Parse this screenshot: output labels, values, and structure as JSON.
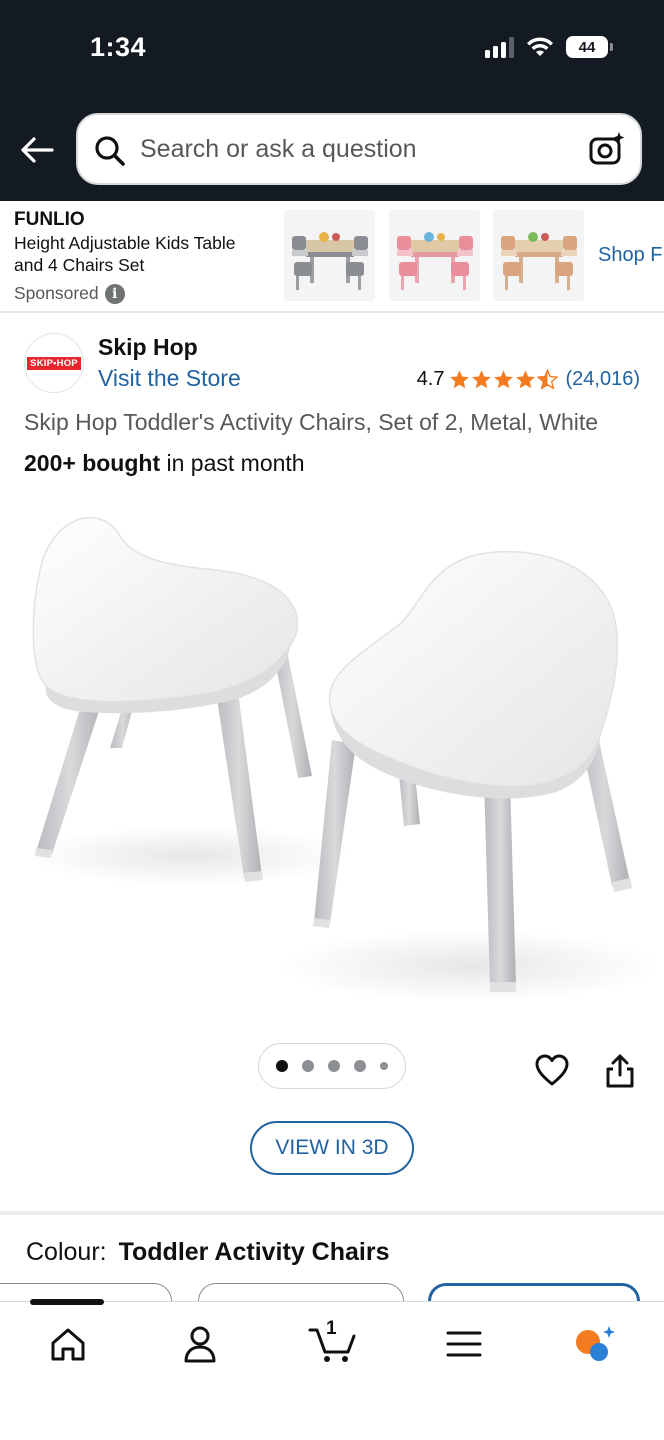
{
  "status_bar": {
    "time": "1:34",
    "battery": "44"
  },
  "search": {
    "placeholder": "Search or ask a question"
  },
  "sponsored_ad": {
    "brand": "FUNLIO",
    "title": "Height Adjustable Kids Table and 4 Chairs Set",
    "label": "Sponsored",
    "shop_link": "Shop FU",
    "thumbnails": [
      "grey-table-set",
      "pink-table-set",
      "natural-table-set"
    ]
  },
  "product": {
    "store_logo_text": "SKIP•HOP",
    "store_name": "Skip Hop",
    "visit_store": "Visit the Store",
    "rating": "4.7",
    "rating_count": "(24,016)",
    "stars": 4.5,
    "title": "Skip Hop Toddler's Activity Chairs, Set of 2, Metal, White",
    "bought_bold": "200+ bought",
    "bought_rest": " in past month",
    "image_count": 5,
    "active_image": 1,
    "view_3d_label": "VIEW IN 3D",
    "colour_label": "Colour:",
    "colour_value": "Toddler Activity Chairs"
  },
  "bottom_nav": {
    "items": [
      "home-icon",
      "account-icon",
      "cart-icon",
      "menu-icon",
      "rufus-assistant-icon"
    ],
    "cart_count": "1"
  },
  "colors": {
    "header_bg": "#131a22",
    "link": "#2162a1",
    "star": "#f47b20"
  }
}
